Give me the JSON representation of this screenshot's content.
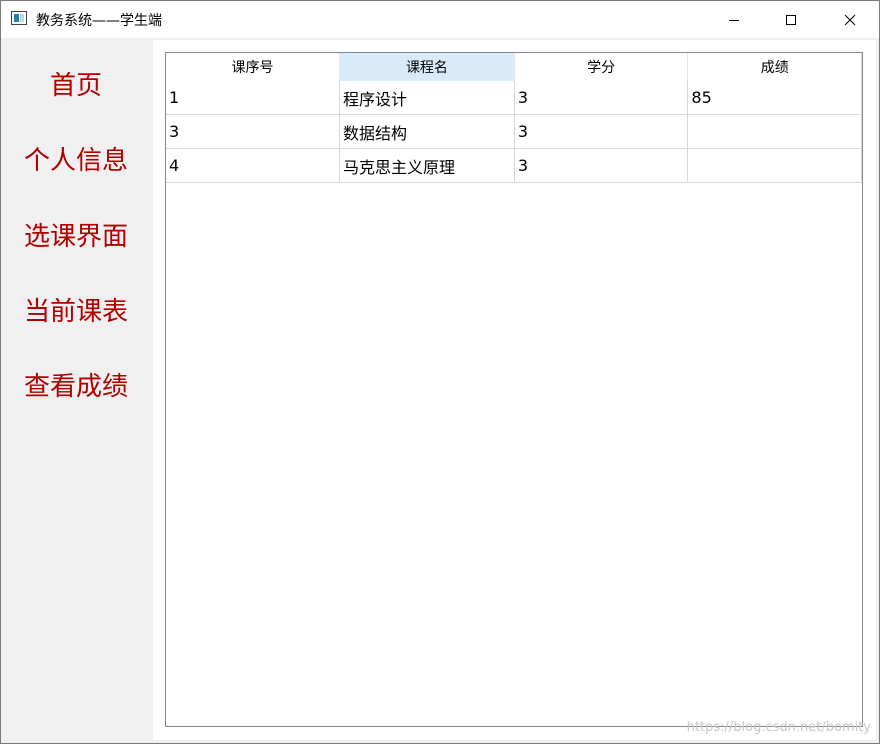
{
  "window": {
    "title": "教务系统——学生端"
  },
  "sidebar": {
    "items": [
      {
        "label": "首页"
      },
      {
        "label": "个人信息"
      },
      {
        "label": "选课界面"
      },
      {
        "label": "当前课表"
      },
      {
        "label": "查看成绩"
      }
    ],
    "item_color": "#b00000"
  },
  "table": {
    "headers": [
      "课序号",
      "课程名",
      "学分",
      "成绩"
    ],
    "selected_header": "课程名",
    "rows": [
      [
        "1",
        "程序设计",
        "3",
        "85"
      ],
      [
        "3",
        "数据结构",
        "3",
        ""
      ],
      [
        "4",
        "马克思主义原理",
        "3",
        ""
      ]
    ]
  },
  "watermark": {
    "text": "https://blog.csdn.net/bomity"
  },
  "icons": {
    "minimize": "minimize-icon",
    "maximize": "maximize-icon",
    "close": "close-icon"
  }
}
